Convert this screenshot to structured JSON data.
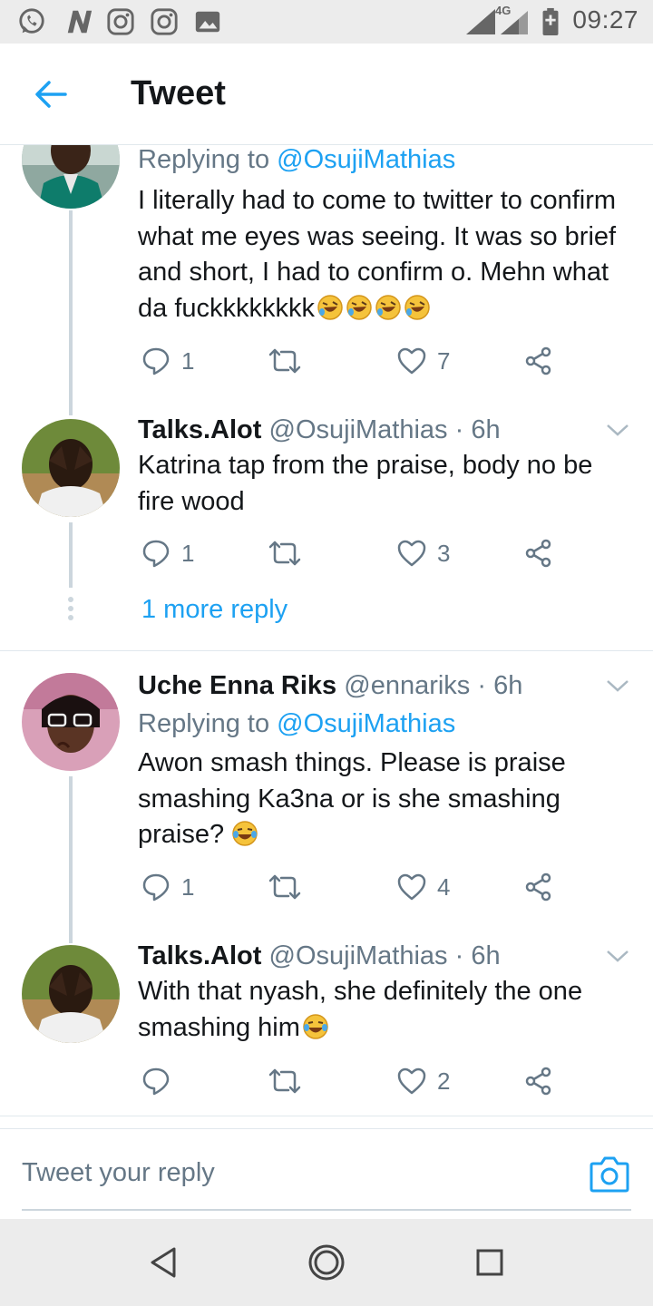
{
  "status_bar": {
    "time": "09:27",
    "network": "4G",
    "icons": [
      "whatsapp-icon",
      "n-app-icon",
      "instagram-icon",
      "instagram-icon",
      "image-icon",
      "signal-icon",
      "battery-icon"
    ]
  },
  "app_bar": {
    "title": "Tweet",
    "back_icon": "arrow-left-icon"
  },
  "colors": {
    "accent": "#1da1f2",
    "secondary_text": "#657786",
    "thread_line": "#ccd6dd"
  },
  "tweets": [
    {
      "replying_prefix": "Replying to",
      "replying_to": "@OsujiMathias",
      "text": "I literally had to come to twitter to confirm what me eyes was seeing. It was so brief and short, I had to confirm o. Mehn what da fuckkkkkkkk",
      "emoji": "rofl-emoji-x4",
      "replies": "1",
      "retweets": "",
      "likes": "7"
    },
    {
      "name": "Talks.Alot",
      "handle": "@OsujiMathias",
      "time": "· 6h",
      "text": "Katrina tap from the praise, body no be fire wood",
      "replies": "1",
      "retweets": "",
      "likes": "3"
    },
    {
      "name": "Uche Enna Riks",
      "handle": "@ennariks",
      "time": "· 6h",
      "replying_prefix": "Replying to",
      "replying_to": "@OsujiMathias",
      "text": "Awon smash things. Please is praise smashing Ka3na or is she smashing praise?",
      "emoji": "joy-emoji",
      "replies": "1",
      "retweets": "",
      "likes": "4"
    },
    {
      "name": "Talks.Alot",
      "handle": "@OsujiMathias",
      "time": "· 6h",
      "text": "With that nyash, she definitely the one smashing him",
      "emoji": "joy-emoji",
      "replies": "",
      "retweets": "",
      "likes": "2"
    }
  ],
  "more_reply": "1 more reply",
  "composer": {
    "placeholder": "Tweet your reply",
    "camera_icon": "camera-icon"
  },
  "nav_bar": {
    "icons": [
      "back-triangle-icon",
      "home-circle-icon",
      "recents-square-icon"
    ]
  }
}
